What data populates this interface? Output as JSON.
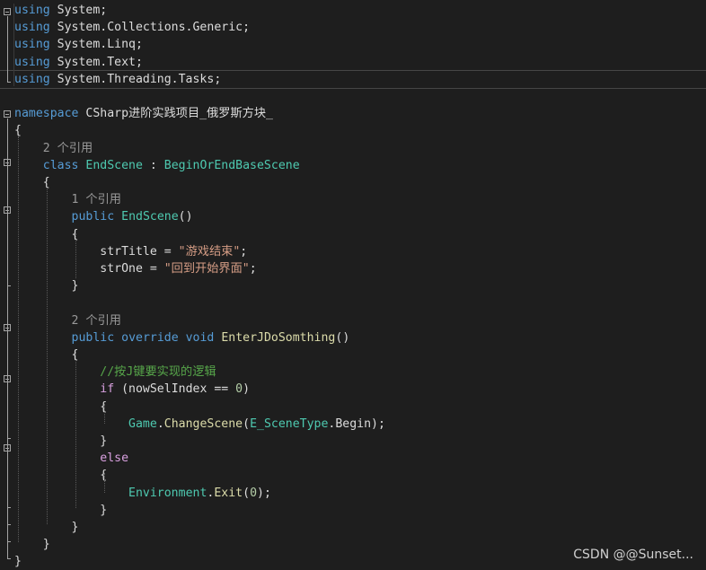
{
  "lines": [
    [
      {
        "t": "using",
        "c": "kw"
      },
      {
        "t": " System;",
        "c": ""
      }
    ],
    [
      {
        "t": "using",
        "c": "kw"
      },
      {
        "t": " System.Collections.Generic;",
        "c": ""
      }
    ],
    [
      {
        "t": "using",
        "c": "kw"
      },
      {
        "t": " System.Linq;",
        "c": ""
      }
    ],
    [
      {
        "t": "using",
        "c": "kw"
      },
      {
        "t": " System.Text;",
        "c": ""
      }
    ],
    [
      {
        "t": "using",
        "c": "kw"
      },
      {
        "t": " System.Threading.Tasks;",
        "c": ""
      }
    ],
    [],
    [
      {
        "t": "namespace",
        "c": "kw"
      },
      {
        "t": " CSharp进阶实践项目_俄罗斯方块_",
        "c": ""
      }
    ],
    [
      {
        "t": "{",
        "c": ""
      }
    ],
    [
      {
        "t": "    2 个引用",
        "c": "hint"
      }
    ],
    [
      {
        "t": "    ",
        "c": ""
      },
      {
        "t": "class",
        "c": "kw"
      },
      {
        "t": " ",
        "c": ""
      },
      {
        "t": "EndScene",
        "c": "type"
      },
      {
        "t": " : ",
        "c": ""
      },
      {
        "t": "BeginOrEndBaseScene",
        "c": "type"
      }
    ],
    [
      {
        "t": "    {",
        "c": ""
      }
    ],
    [
      {
        "t": "        1 个引用",
        "c": "hint"
      }
    ],
    [
      {
        "t": "        ",
        "c": ""
      },
      {
        "t": "public",
        "c": "kw"
      },
      {
        "t": " ",
        "c": ""
      },
      {
        "t": "EndScene",
        "c": "type"
      },
      {
        "t": "()",
        "c": ""
      }
    ],
    [
      {
        "t": "        {",
        "c": ""
      }
    ],
    [
      {
        "t": "            strTitle = ",
        "c": ""
      },
      {
        "t": "\"游戏结束\"",
        "c": "str"
      },
      {
        "t": ";",
        "c": ""
      }
    ],
    [
      {
        "t": "            strOne = ",
        "c": ""
      },
      {
        "t": "\"回到开始界面\"",
        "c": "str"
      },
      {
        "t": ";",
        "c": ""
      }
    ],
    [
      {
        "t": "        }",
        "c": ""
      }
    ],
    [],
    [
      {
        "t": "        2 个引用",
        "c": "hint"
      }
    ],
    [
      {
        "t": "        ",
        "c": ""
      },
      {
        "t": "public",
        "c": "kw"
      },
      {
        "t": " ",
        "c": ""
      },
      {
        "t": "override",
        "c": "kw"
      },
      {
        "t": " ",
        "c": ""
      },
      {
        "t": "void",
        "c": "kw"
      },
      {
        "t": " ",
        "c": ""
      },
      {
        "t": "EnterJDoSomthing",
        "c": "meth"
      },
      {
        "t": "()",
        "c": ""
      }
    ],
    [
      {
        "t": "        {",
        "c": ""
      }
    ],
    [
      {
        "t": "            ",
        "c": ""
      },
      {
        "t": "//按J键要实现的逻辑",
        "c": "cmt"
      }
    ],
    [
      {
        "t": "            ",
        "c": ""
      },
      {
        "t": "if",
        "c": "ctrl"
      },
      {
        "t": " (nowSelIndex == ",
        "c": ""
      },
      {
        "t": "0",
        "c": "num"
      },
      {
        "t": ")",
        "c": ""
      }
    ],
    [
      {
        "t": "            {",
        "c": ""
      }
    ],
    [
      {
        "t": "                ",
        "c": ""
      },
      {
        "t": "Game",
        "c": "type"
      },
      {
        "t": ".",
        "c": ""
      },
      {
        "t": "ChangeScene",
        "c": "meth"
      },
      {
        "t": "(",
        "c": ""
      },
      {
        "t": "E_SceneType",
        "c": "type"
      },
      {
        "t": ".Begin);",
        "c": ""
      }
    ],
    [
      {
        "t": "            }",
        "c": ""
      }
    ],
    [
      {
        "t": "            ",
        "c": ""
      },
      {
        "t": "else",
        "c": "ctrl"
      }
    ],
    [
      {
        "t": "            {",
        "c": ""
      }
    ],
    [
      {
        "t": "                ",
        "c": ""
      },
      {
        "t": "Environment",
        "c": "type"
      },
      {
        "t": ".",
        "c": ""
      },
      {
        "t": "Exit",
        "c": "meth"
      },
      {
        "t": "(",
        "c": ""
      },
      {
        "t": "0",
        "c": "num"
      },
      {
        "t": ");",
        "c": ""
      }
    ],
    [
      {
        "t": "            }",
        "c": ""
      }
    ],
    [
      {
        "t": "        }",
        "c": ""
      }
    ],
    [
      {
        "t": "    }",
        "c": ""
      }
    ],
    [
      {
        "t": "}",
        "c": ""
      }
    ]
  ],
  "current_line": 4,
  "watermark": "CSDN @@Sunset..."
}
